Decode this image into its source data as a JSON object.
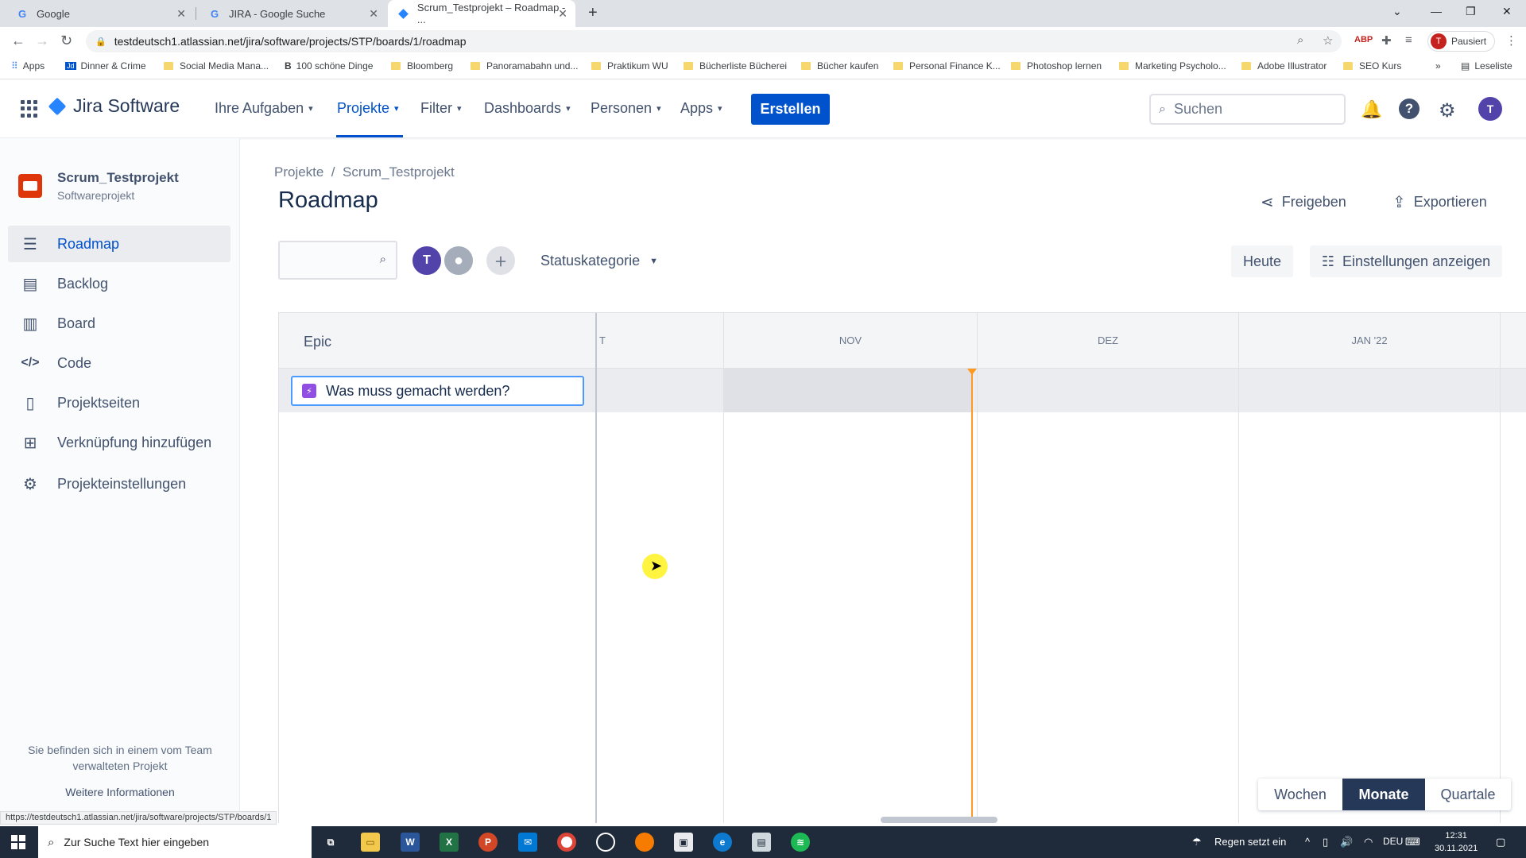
{
  "browser": {
    "tabs": [
      {
        "title": "Google",
        "favicon": "G",
        "active": false
      },
      {
        "title": "JIRA - Google Suche",
        "favicon": "G",
        "active": false
      },
      {
        "title": "Scrum_Testprojekt – Roadmap - ...",
        "favicon": "jira-diamond",
        "active": true
      }
    ],
    "url": "testdeutsch1.atlassian.net/jira/software/projects/STP/boards/1/roadmap",
    "profile_status": "Pausiert",
    "profile_initial": "T",
    "bookmarks": [
      "Apps",
      "Dinner & Crime",
      "Social Media Mana...",
      "100 schöne Dinge",
      "Bloomberg",
      "Panoramabahn und...",
      "Praktikum WU",
      "Bücherliste Bücherei",
      "Bücher kaufen",
      "Personal Finance K...",
      "Photoshop lernen",
      "Marketing Psycholo...",
      "Adobe Illustrator",
      "SEO Kurs",
      "Leseliste"
    ],
    "status_url": "https://testdeutsch1.atlassian.net/jira/software/projects/STP/boards/1"
  },
  "nav": {
    "logo": "Jira Software",
    "items": [
      "Ihre Aufgaben",
      "Projekte",
      "Filter",
      "Dashboards",
      "Personen",
      "Apps"
    ],
    "active_item": "Projekte",
    "create": "Erstellen",
    "search_placeholder": "Suchen",
    "user_initial": "T"
  },
  "sidebar": {
    "project_name": "Scrum_Testprojekt",
    "project_type": "Softwareprojekt",
    "items": [
      {
        "label": "Roadmap",
        "icon": "roadmap-icon",
        "active": true
      },
      {
        "label": "Backlog",
        "icon": "backlog-icon"
      },
      {
        "label": "Board",
        "icon": "board-icon"
      },
      {
        "label": "Code",
        "icon": "code-icon"
      },
      {
        "label": "Projektseiten",
        "icon": "pages-icon"
      },
      {
        "label": "Verknüpfung hinzufügen",
        "icon": "add-shortcut-icon"
      },
      {
        "label": "Projekteinstellungen",
        "icon": "settings-icon"
      }
    ],
    "team_note": "Sie befinden sich in einem vom Team verwalteten Projekt",
    "more_info": "Weitere Informationen"
  },
  "main": {
    "breadcrumb": "Projekte  /  Scrum_Testprojekt",
    "title": "Roadmap",
    "share": "Freigeben",
    "export": "Exportieren",
    "status_filter": "Statuskategorie",
    "today": "Heute",
    "view_settings": "Einstellungen anzeigen",
    "avatar_initial": "T"
  },
  "roadmap": {
    "epic_column": "Epic",
    "months": [
      "T",
      "NOV",
      "DEZ",
      "JAN '22"
    ],
    "new_epic_input": "Was muss gemacht werden?",
    "zoom_options": [
      "Wochen",
      "Monate",
      "Quartale"
    ],
    "zoom_active": "Monate"
  },
  "taskbar": {
    "search_placeholder": "Zur Suche Text hier eingeben",
    "weather": "Regen setzt ein",
    "language": "DEU",
    "time": "12:31",
    "date": "30.11.2021"
  },
  "colors": {
    "brand": "#0052CC",
    "today_line": "#FF991F",
    "epic": "#904EE2",
    "active_zoom": "#253858"
  }
}
